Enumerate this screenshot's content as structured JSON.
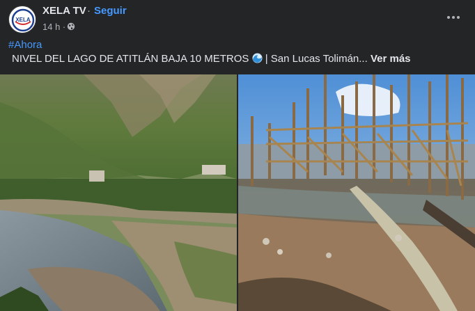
{
  "post": {
    "page_name": "XELA TV",
    "separator": "·",
    "follow_label": "Seguir",
    "time": "14 h ·",
    "privacy_icon": "globe-icon",
    "more_icon": "more-icon",
    "hashtag": "#Ahora",
    "caption_part1": "NIVEL DEL LAGO DE ATITLÁN BAJA 10 METROS",
    "caption_emoji": "water-wave-icon",
    "caption_part2": " | San Lucas Tolimán...",
    "see_more": "Ver más",
    "avatar_text": "XELA"
  },
  "colors": {
    "background": "#242526",
    "text": "#e4e6eb",
    "secondary": "#b0b3b8",
    "link": "#4599ff"
  },
  "photos": [
    {
      "name": "lake-shore-photo",
      "alt": "Lago de Atitlán shoreline with mountains"
    },
    {
      "name": "dock-construction-photo",
      "alt": "Wooden pilings on dry lake bed"
    }
  ]
}
